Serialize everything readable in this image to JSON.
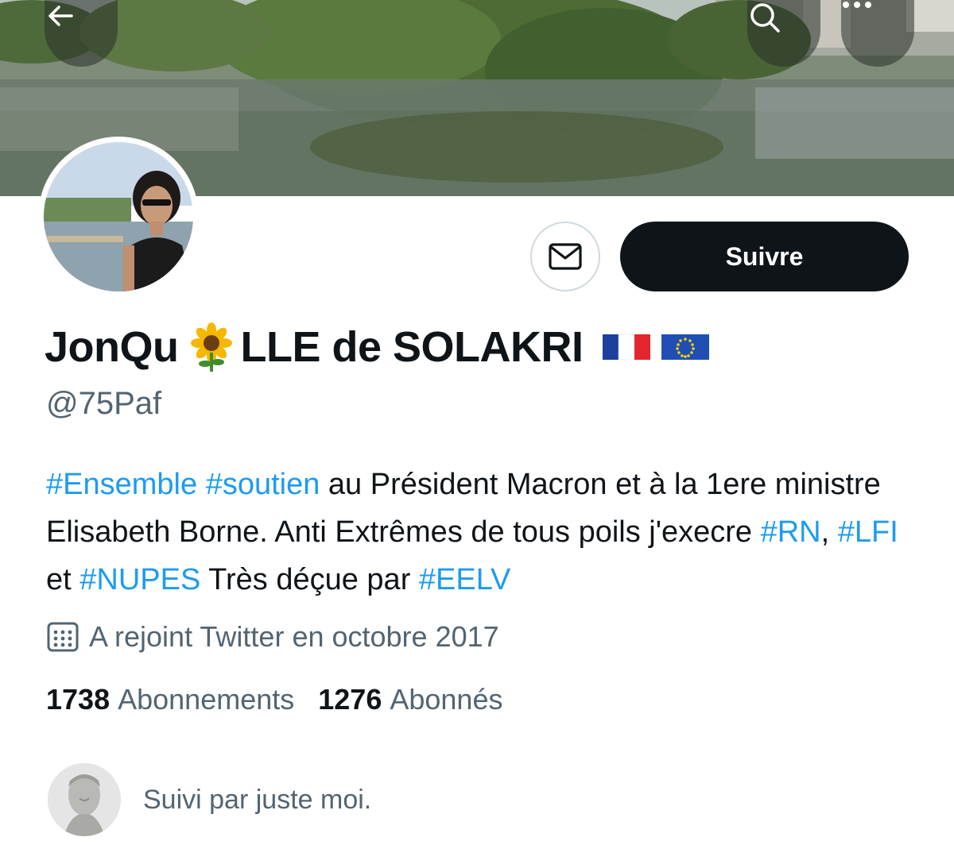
{
  "header": {
    "back_icon": "arrow-left-icon",
    "search_icon": "search-icon",
    "more_icon": "more-horizontal-icon"
  },
  "profile": {
    "name_part1": "JonQu",
    "name_emoji": "sunflower",
    "name_part2": "LLE de SOLAKRI",
    "name_flags": [
      "flag-france",
      "flag-european-union"
    ],
    "handle": "@75Paf",
    "bio": [
      {
        "text": "#Ensemble",
        "tag": true
      },
      {
        "text": " ",
        "tag": false
      },
      {
        "text": "#soutien",
        "tag": true
      },
      {
        "text": " au Président Macron et à la 1ere ministre Elisabeth Borne. Anti Extrêmes de tous poils j'execre ",
        "tag": false
      },
      {
        "text": "#RN",
        "tag": true
      },
      {
        "text": ", ",
        "tag": false
      },
      {
        "text": "#LFI",
        "tag": true
      },
      {
        "text": " et ",
        "tag": false
      },
      {
        "text": "#NUPES",
        "tag": true
      },
      {
        "text": " Très déçue par ",
        "tag": false
      },
      {
        "text": "#EELV",
        "tag": true
      }
    ],
    "joined": "A rejoint Twitter en octobre 2017",
    "following_count": "1738",
    "following_label": "Abonnements",
    "followers_count": "1276",
    "followers_label": "Abonnés",
    "followed_by": "Suivi par juste moi."
  },
  "actions": {
    "message_icon": "envelope-icon",
    "follow_label": "Suivre"
  },
  "colors": {
    "accent": "#1d9bf0",
    "text": "#0f1419",
    "muted": "#536471",
    "button_dark": "#0f1419"
  }
}
